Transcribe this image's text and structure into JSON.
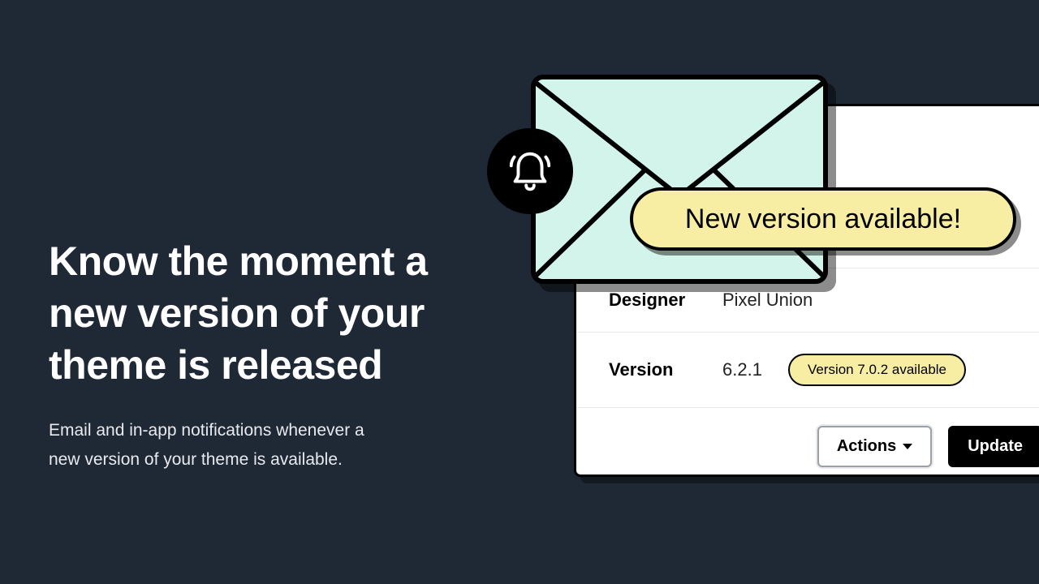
{
  "hero": {
    "headline": "Know the moment a new version of your theme is released",
    "subtext": "Email and in-app notifications whenever a new version of your theme is available."
  },
  "notification_pill": "New version available!",
  "card": {
    "designer_label": "Designer",
    "designer_value": "Pixel Union",
    "version_label": "Version",
    "version_value": "6.2.1",
    "available_badge": "Version 7.0.2 available",
    "actions_label": "Actions",
    "update_label": "Update"
  }
}
